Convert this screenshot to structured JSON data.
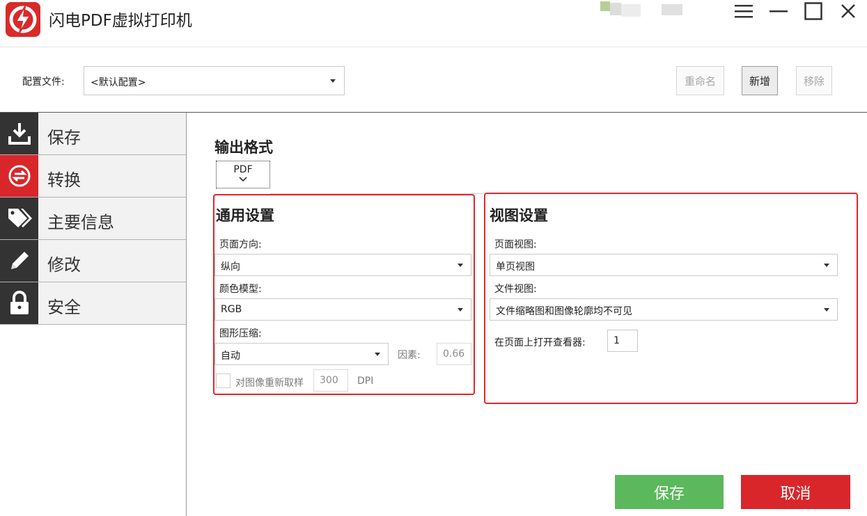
{
  "app": {
    "title": "闪电PDF虚拟打印机"
  },
  "config": {
    "label": "配置文件:",
    "selected": "<默认配置>",
    "rename_label": "重命名",
    "new_label": "新增",
    "remove_label": "移除"
  },
  "sidebar": {
    "items": [
      {
        "label": "保存",
        "icon": "download-icon"
      },
      {
        "label": "转换",
        "icon": "convert-icon",
        "active": true
      },
      {
        "label": "主要信息",
        "icon": "tags-icon"
      },
      {
        "label": "修改",
        "icon": "pencil-icon"
      },
      {
        "label": "安全",
        "icon": "lock-icon"
      }
    ]
  },
  "main": {
    "output_format_title": "输出格式",
    "format_tab": "PDF",
    "general": {
      "title": "通用设置",
      "orientation_label": "页面方向:",
      "orientation_value": "纵向",
      "color_model_label": "颜色模型:",
      "color_model_value": "RGB",
      "compression_label": "图形压缩:",
      "compression_value": "自动",
      "factor_label": "因素:",
      "factor_value": "0.66",
      "resample_label": "对图像重新取样",
      "resample_checked": false,
      "dpi_value": "300",
      "dpi_unit": "DPI"
    },
    "view": {
      "title": "视图设置",
      "page_view_label": "页面视图:",
      "page_view_value": "单页视图",
      "doc_view_label": "文件视图:",
      "doc_view_value": "文件缩略图和图像轮廓均不可见",
      "open_page_label": "在页面上打开查看器:",
      "open_page_value": "1"
    }
  },
  "footer": {
    "save_label": "保存",
    "cancel_label": "取消"
  },
  "colors": {
    "accent_red": "#d9262b",
    "save_green": "#5cb85c",
    "cancel_red": "#d9262b",
    "highlight_red": "#e8232b"
  }
}
